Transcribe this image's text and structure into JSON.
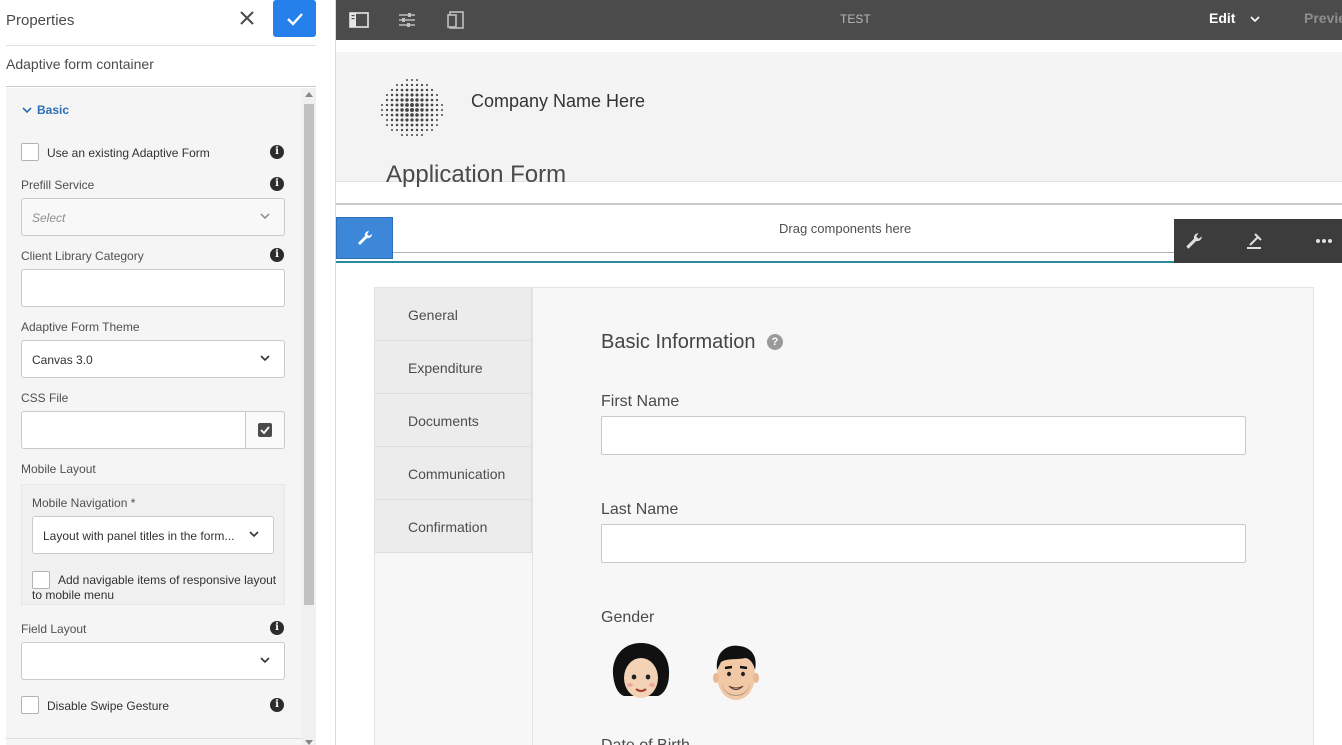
{
  "properties_panel": {
    "title": "Properties",
    "subtitle": "Adaptive form container",
    "section_basic": "Basic",
    "use_existing_label": "Use an existing Adaptive Form",
    "prefill_service_label": "Prefill Service",
    "prefill_service_value": "Select",
    "client_library_label": "Client Library Category",
    "client_library_value": "",
    "theme_label": "Adaptive Form Theme",
    "theme_value": "Canvas 3.0",
    "css_file_label": "CSS File",
    "css_file_value": "",
    "mobile_layout_label": "Mobile Layout",
    "mobile_navigation_label": "Mobile Navigation *",
    "mobile_navigation_value": "Layout with panel titles in the form...",
    "add_navigable_label": "Add navigable items of responsive layout to mobile menu",
    "field_layout_label": "Field Layout",
    "field_layout_value": "",
    "disable_swipe_label": "Disable Swipe Gesture"
  },
  "topbar": {
    "page_title": "TEST",
    "mode_label": "Edit",
    "preview_label": "Preview",
    "icons": [
      "side-panel-icon",
      "properties-icon",
      "emulator-icon"
    ]
  },
  "canvas": {
    "company_name": "Company Name Here",
    "form_title": "Application Form",
    "drag_hint": "Drag components here",
    "tabs": [
      "General",
      "Expenditure",
      "Documents",
      "Communication",
      "Confirmation"
    ],
    "section_title": "Basic Information",
    "help_symbol": "?",
    "first_name_label": "First Name",
    "last_name_label": "Last Name",
    "gender_label": "Gender",
    "dob_label": "Date of Birth"
  },
  "colors": {
    "accent": "#2680eb",
    "topbar": "#4b4b4b",
    "link": "#2c6fb5"
  }
}
